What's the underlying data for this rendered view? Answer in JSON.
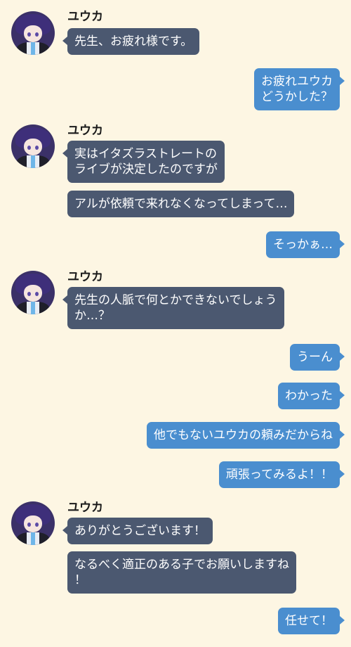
{
  "colors": {
    "background": "#fdf6e3",
    "incoming_bubble": "#4b5870",
    "outgoing_bubble": "#4a8ecf",
    "name_text": "#1a1a1a"
  },
  "chat": {
    "sender_name": "ユウカ",
    "group1": {
      "msg1": "先生、お疲れ様です。"
    },
    "out1": "お疲れユウカ\nどうかした？",
    "group2": {
      "msg1": "実はイタズラストレートの\nライブが決定したのですが",
      "msg2": "アルが依頼で来れなくなってしまって…"
    },
    "out2": "そっかぁ…",
    "group3": {
      "msg1": "先生の人脈で何とかできないでしょう\nか…？"
    },
    "out3": "うーん",
    "out4": "わかった",
    "out5": "他でもないユウカの頼みだからね",
    "out6": "頑張ってみるよ！！",
    "group4": {
      "msg1": "ありがとうございます！",
      "msg2": "なるべく適正のある子でお願いしますね\n！"
    },
    "out7": "任せて！"
  }
}
